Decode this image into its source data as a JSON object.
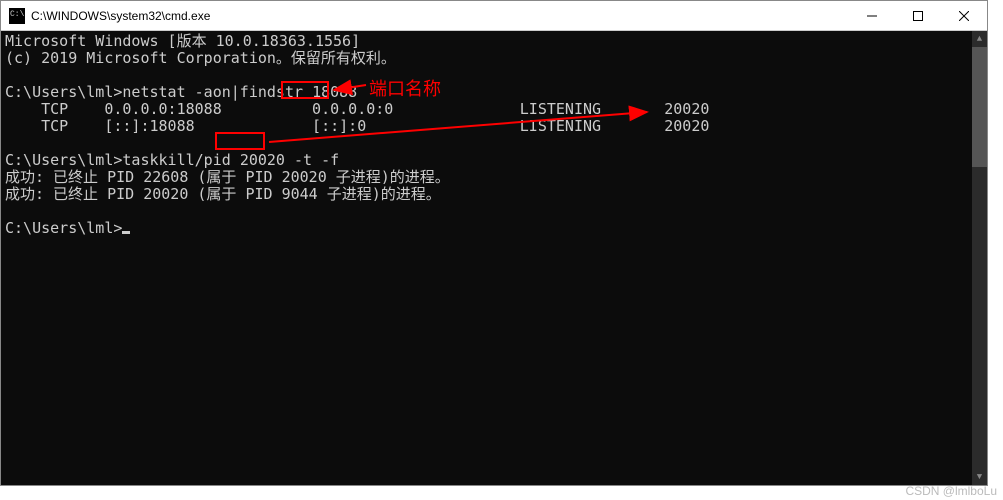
{
  "window": {
    "title": "C:\\WINDOWS\\system32\\cmd.exe"
  },
  "terminal": {
    "line1": "Microsoft Windows [版本 10.0.18363.1556]",
    "line2": "(c) 2019 Microsoft Corporation。保留所有权利。",
    "line3": "",
    "prompt1": "C:\\Users\\lml>",
    "cmd1_a": "netstat -aon|findstr ",
    "cmd1_b": "18088",
    "row1_a": "    TCP    0.0.0.0:18088          0.0.0.0:0              LISTENING       20020",
    "row2_a": "    TCP    [::]:18088             [::]:0                 LISTENING       20020",
    "line6": "",
    "prompt2": "C:\\Users\\lml>",
    "cmd2_a": "taskkill/pid ",
    "cmd2_b": "20020",
    "cmd2_c": " -t -f",
    "res1": "成功: 已终止 PID 22608 (属于 PID 20020 子进程)的进程。",
    "res2": "成功: 已终止 PID 20020 (属于 PID 9044 子进程)的进程。",
    "line9": "",
    "prompt3": "C:\\Users\\lml>"
  },
  "annotations": {
    "port_label": "端口名称",
    "box1_value": "18088",
    "box2_value": "20020"
  },
  "watermark": "CSDN @lmlboLu"
}
